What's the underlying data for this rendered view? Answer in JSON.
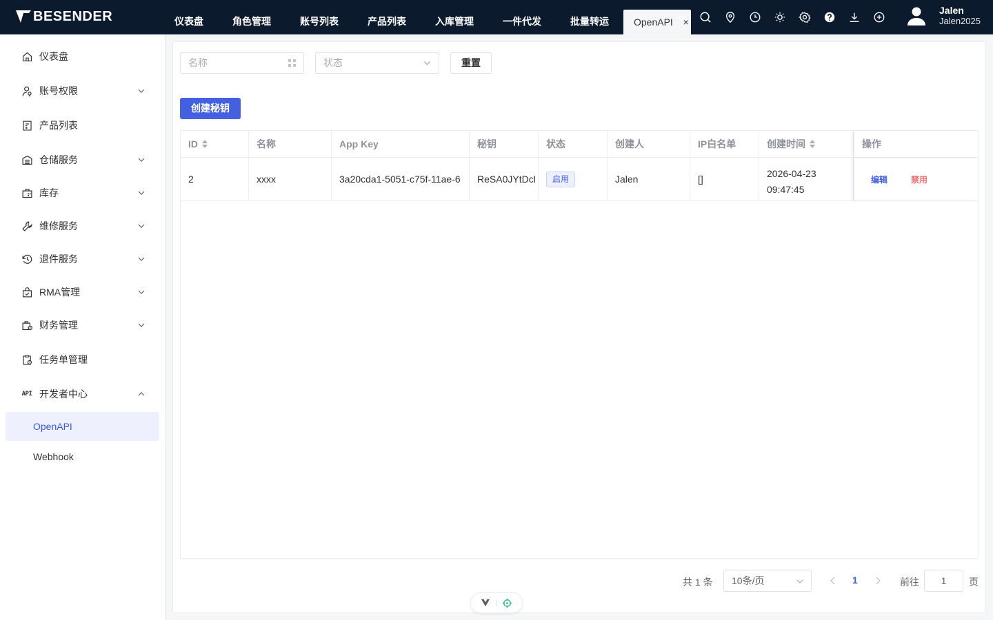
{
  "app": {
    "logo_text": "BESENDER"
  },
  "topnav": {
    "tabs": [
      "仪表盘",
      "角色管理",
      "账号列表",
      "产品列表",
      "入库管理",
      "一件代发",
      "批量转运"
    ],
    "active_tab": "OpenAPI",
    "close_glyph": "×"
  },
  "user": {
    "name": "Jalen",
    "id": "Jalen2025"
  },
  "sidebar": {
    "items": [
      {
        "label": "仪表盘",
        "icon": "home-icon"
      },
      {
        "label": "账号权限",
        "icon": "user-key-icon"
      },
      {
        "label": "产品列表",
        "icon": "list-box-icon"
      },
      {
        "label": "仓储服务",
        "icon": "warehouse-icon"
      },
      {
        "label": "库存",
        "icon": "stock-icon"
      },
      {
        "label": "维修服务",
        "icon": "wrench-icon"
      },
      {
        "label": "退件服务",
        "icon": "return-icon"
      },
      {
        "label": "RMA管理",
        "icon": "rma-bag-icon"
      },
      {
        "label": "财务管理",
        "icon": "finance-icon"
      },
      {
        "label": "任务单管理",
        "icon": "task-clipboard-icon"
      },
      {
        "label": "开发者中心",
        "icon": "api-icon"
      }
    ],
    "api_icon_text": "API",
    "sub_items": [
      {
        "label": "OpenAPI",
        "active": true
      },
      {
        "label": "Webhook",
        "active": false
      }
    ]
  },
  "filters": {
    "name_placeholder": "名称",
    "status_placeholder": "状态",
    "reset_label": "重置"
  },
  "create_button": "创建秘钥",
  "table": {
    "columns": [
      "ID",
      "名称",
      "App Key",
      "秘钥",
      "状态",
      "创建人",
      "IP白名单",
      "创建时间",
      "操作"
    ],
    "rows": [
      {
        "id": "2",
        "name": "xxxx",
        "app_key": "3a20cda1-5051-c75f-11ae-6",
        "secret": "ReSA0JYtDcl",
        "status": "启用",
        "creator": "Jalen",
        "ip_whitelist": "[]",
        "created_date": "2026-04-23",
        "created_time": "09:47:45",
        "edit": "编辑",
        "disable": "禁用"
      }
    ]
  },
  "pagination": {
    "total": "共 1 条",
    "page_size": "10条/页",
    "current": "1",
    "goto_prefix": "前往",
    "goto_value": "1",
    "goto_suffix": "页"
  },
  "colors": {
    "topbar": "#0c1a2e",
    "primary": "#4360e0",
    "danger": "#f56c6c"
  }
}
